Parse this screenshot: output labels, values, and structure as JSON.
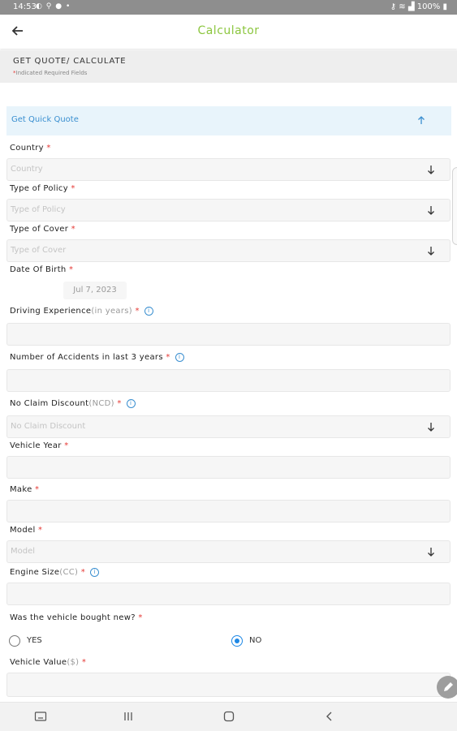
{
  "status_bar": {
    "time": "14:53",
    "battery": "100%"
  },
  "app_bar": {
    "title": "Calculator"
  },
  "section": {
    "heading": "GET QUOTE/ CALCULATE",
    "required_note": "Indicated Required Fields",
    "required_marker": "*"
  },
  "quick_quote": {
    "label": "Get Quick Quote"
  },
  "form": {
    "required_marker": "*",
    "country": {
      "label": "Country",
      "placeholder": "Country"
    },
    "policy_type": {
      "label": "Type of Policy",
      "placeholder": "Type of Policy"
    },
    "cover_type": {
      "label": "Type of Cover",
      "placeholder": "Type of Cover"
    },
    "dob": {
      "label": "Date Of Birth",
      "value": "Jul 7, 2023"
    },
    "driving_experience": {
      "label": "Driving Experience",
      "hint": "(in years)"
    },
    "accidents": {
      "label": "Number of Accidents in last 3 years"
    },
    "ncd": {
      "label": "No Claim Discount",
      "hint": "(NCD)",
      "placeholder": "No Claim Discount"
    },
    "vehicle_year": {
      "label": "Vehicle Year"
    },
    "make": {
      "label": "Make"
    },
    "model": {
      "label": "Model",
      "placeholder": "Model"
    },
    "engine_size": {
      "label": "Engine Size",
      "hint": "(CC)"
    },
    "bought_new": {
      "label": "Was the vehicle bought new?",
      "yes_label": "YES",
      "no_label": "NO",
      "selected": "NO"
    },
    "vehicle_value": {
      "label": "Vehicle Value",
      "hint": "($)"
    }
  },
  "icons": {
    "info_glyph": "i",
    "status": "notification, location, app icons; wifi, signal, battery",
    "nav": [
      "keyboard-icon",
      "recents-icon",
      "home-icon",
      "back-nav-icon"
    ]
  },
  "colors": {
    "accent_green": "#8cc63f",
    "link_blue": "#3a8fd0",
    "required_red": "#e53935",
    "radio_blue": "#1e88e5"
  }
}
